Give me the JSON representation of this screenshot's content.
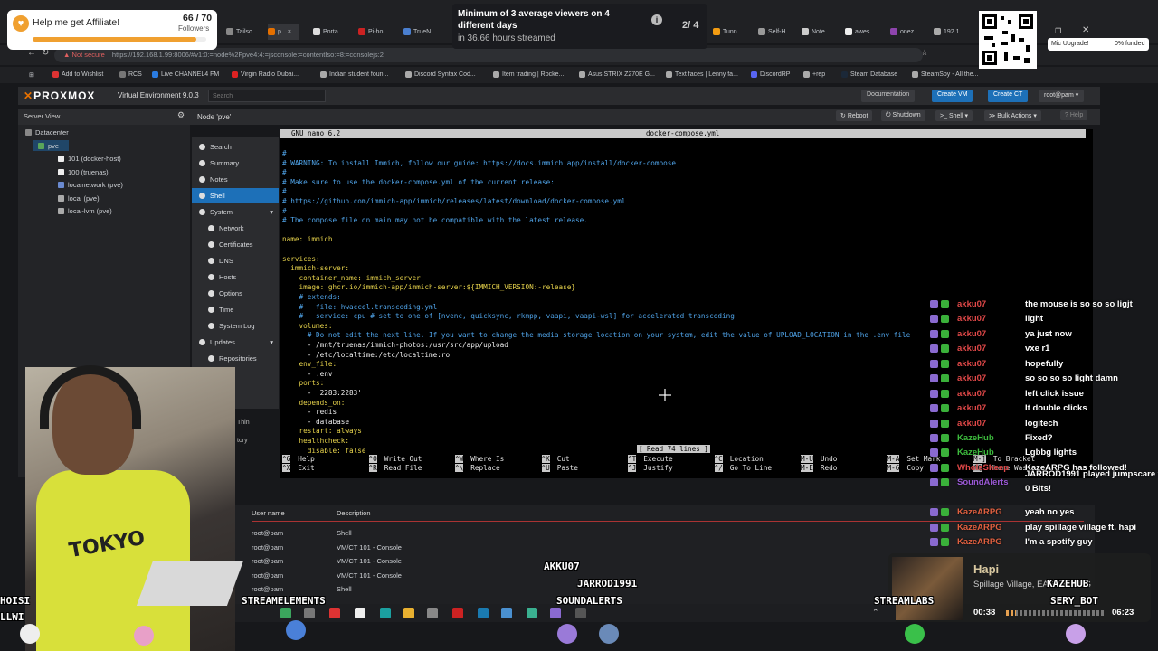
{
  "browser": {
    "tabs": [
      "Tailsc",
      "p",
      "Porta",
      "Pi-ho",
      "TrueN",
      "Tunn",
      "Self-H",
      "Note",
      "awes",
      "onez",
      "192.1"
    ],
    "security_label": "Not secure",
    "url": "https://192.168.1.99:8006/#v1:0:=node%2Fpve4:4:=jsconsole:=contentIso:=8:=consolejs:2",
    "bookmarks": [
      "Add to Wishlist",
      "RCS",
      "Live CHANNEL4 FM",
      "Virgin Radio Dubai...",
      "Indian student foun...",
      "Discord Syntax Cod...",
      "Item trading | Rocke...",
      "Asus STRIX Z270E G...",
      "Text faces | Lenny fa...",
      "DiscordRP",
      "+rep",
      "Steam Database",
      "SteamSpy - All the..."
    ]
  },
  "proxmox": {
    "logo": "PROXMOX",
    "product": "Virtual Environment 9.0.3",
    "search_placeholder": "Search",
    "header_buttons": [
      "Documentation",
      "Create VM",
      "Create CT",
      "root@pam"
    ],
    "server_view": "Server View",
    "node_title": "Node 'pve'",
    "node_buttons": [
      "Reboot",
      "Shutdown",
      "Shell",
      "Bulk Actions",
      "Help"
    ],
    "tree": [
      {
        "label": "Datacenter",
        "indent": 0
      },
      {
        "label": "pve",
        "indent": 1
      },
      {
        "label": "101 (docker-host)",
        "indent": 2
      },
      {
        "label": "100 (truenas)",
        "indent": 2
      },
      {
        "label": "localnetwork (pve)",
        "indent": 2
      },
      {
        "label": "local (pve)",
        "indent": 2
      },
      {
        "label": "local-lvm (pve)",
        "indent": 2
      }
    ],
    "nav": [
      {
        "label": "Search",
        "sub": false,
        "active": false
      },
      {
        "label": "Summary",
        "sub": false,
        "active": false
      },
      {
        "label": "Notes",
        "sub": false,
        "active": false
      },
      {
        "label": "Shell",
        "sub": false,
        "active": true
      },
      {
        "label": "System",
        "sub": false,
        "active": false
      },
      {
        "label": "Network",
        "sub": true,
        "active": false
      },
      {
        "label": "Certificates",
        "sub": true,
        "active": false
      },
      {
        "label": "DNS",
        "sub": true,
        "active": false
      },
      {
        "label": "Hosts",
        "sub": true,
        "active": false
      },
      {
        "label": "Options",
        "sub": true,
        "active": false
      },
      {
        "label": "Time",
        "sub": true,
        "active": false
      },
      {
        "label": "System Log",
        "sub": true,
        "active": false
      },
      {
        "label": "Updates",
        "sub": false,
        "active": false
      },
      {
        "label": "Repositories",
        "sub": true,
        "active": false
      }
    ],
    "nav_extra": [
      "Thin",
      "tory"
    ],
    "tasks": {
      "headers": [
        "User name",
        "Description"
      ],
      "rows": [
        [
          "root@pam",
          "Shell"
        ],
        [
          "root@pam",
          "VM/CT 101 - Console"
        ],
        [
          "root@pam",
          "VM/CT 101 - Console"
        ],
        [
          "root@pam",
          "VM/CT 101 - Console"
        ],
        [
          "root@pam",
          "Shell"
        ]
      ]
    }
  },
  "nano": {
    "version": "GNU nano 6.2",
    "filename": "docker-compose.yml",
    "status": "[ Read 74 lines ]",
    "lines": [
      "#",
      "# WARNING: To install Immich, follow our guide: https://docs.immich.app/install/docker-compose",
      "#",
      "# Make sure to use the docker-compose.yml of the current release:",
      "#",
      "# https://github.com/immich-app/immich/releases/latest/download/docker-compose.yml",
      "#",
      "# The compose file on main may not be compatible with the latest release.",
      "",
      "name: immich",
      "",
      "services:",
      "  immich-server:",
      "    container_name: immich_server",
      "    image: ghcr.io/immich-app/immich-server:${IMMICH_VERSION:-release}",
      "    # extends:",
      "    #   file: hwaccel.transcoding.yml",
      "    #   service: cpu # set to one of [nvenc, quicksync, rkmpp, vaapi, vaapi-wsl] for accelerated transcoding",
      "    volumes:",
      "      # Do not edit the next line. If you want to change the media storage location on your system, edit the value of UPLOAD_LOCATION in the .env file",
      "      - /mnt/truenas/immich-photos:/usr/src/app/upload",
      "      - /etc/localtime:/etc/localtime:ro",
      "    env_file:",
      "      - .env",
      "    ports:",
      "      - '2283:2283'",
      "    depends_on:",
      "      - redis",
      "      - database",
      "    restart: always",
      "    healthcheck:",
      "      disable: false"
    ],
    "shortcuts": [
      {
        "k1": "^G",
        "l1": "Help",
        "k2": "^X",
        "l2": "Exit"
      },
      {
        "k1": "^O",
        "l1": "Write Out",
        "k2": "^R",
        "l2": "Read File"
      },
      {
        "k1": "^W",
        "l1": "Where Is",
        "k2": "^\\",
        "l2": "Replace"
      },
      {
        "k1": "^K",
        "l1": "Cut",
        "k2": "^U",
        "l2": "Paste"
      },
      {
        "k1": "^T",
        "l1": "Execute",
        "k2": "^J",
        "l2": "Justify"
      },
      {
        "k1": "^C",
        "l1": "Location",
        "k2": "^/",
        "l2": "Go To Line"
      },
      {
        "k1": "M-U",
        "l1": "Undo",
        "k2": "M-E",
        "l2": "Redo"
      },
      {
        "k1": "M-A",
        "l1": "Set Mark",
        "k2": "M-6",
        "l2": "Copy"
      },
      {
        "k1": "M-]",
        "l1": "To Bracket",
        "k2": "^Q",
        "l2": "Where Was"
      }
    ]
  },
  "stream": {
    "affiliate_title": "Help me get Affiliate!",
    "followers_count": "66 / 70",
    "followers_label": "Followers",
    "followers_progress": 0.943,
    "viewers_goal": "Minimum of 3 average viewers on 4 different days",
    "viewers_time": "in 36.66 hours streamed",
    "viewers_page": "2/ 4",
    "mic_upgrade": "Mic Upgrade!",
    "mic_funded": "0% funded",
    "chat": [
      {
        "user": "akku07",
        "msg": "the mouse is so so so ligjt",
        "color": "#e04848"
      },
      {
        "user": "akku07",
        "msg": "light",
        "color": "#e04848"
      },
      {
        "user": "akku07",
        "msg": "ya just now",
        "color": "#e04848"
      },
      {
        "user": "akku07",
        "msg": "vxe r1",
        "color": "#e04848"
      },
      {
        "user": "akku07",
        "msg": "hopefully",
        "color": "#e04848"
      },
      {
        "user": "akku07",
        "msg": "so so so so light damn",
        "color": "#e04848"
      },
      {
        "user": "akku07",
        "msg": "left click issue",
        "color": "#e04848"
      },
      {
        "user": "akku07",
        "msg": "It double clicks",
        "color": "#e04848"
      },
      {
        "user": "akku07",
        "msg": "logitech",
        "color": "#e04848"
      },
      {
        "user": "KazeHub",
        "msg": "Fixed?",
        "color": "#3dbb3d"
      },
      {
        "user": "KazeHub",
        "msg": "Lgbbg lights",
        "color": "#3dbb3d"
      },
      {
        "user": "WhoIsSheep",
        "msg": "KazeARPG has followed!",
        "color": "#e04848"
      },
      {
        "user": "SoundAlerts",
        "msg": "JARROD1991 played jumpscare for 0 Bits!",
        "color": "#9b59d6"
      },
      {
        "user": "KazeARPG",
        "msg": "yeah no yes",
        "color": "#e06040"
      },
      {
        "user": "KazeARPG",
        "msg": "play spillage village ft. hapi",
        "color": "#e06040"
      },
      {
        "user": "KazeARPG",
        "msg": "I'm a spotify guy",
        "color": "#e06040"
      }
    ],
    "song_title": "Hapi",
    "song_artist": "Spillage Village, EARTHGANG",
    "song_elapsed": "00:38",
    "song_total": "06:23",
    "song_progress": 0.1,
    "overlay_names": [
      "AKKU07",
      "JARROD1991",
      "STREAMELEMENTS",
      "SOUNDALERTS",
      "STREAMLABS",
      "KAZEHUB",
      "SERY_BOT",
      "HOISI",
      "LLWI"
    ]
  }
}
